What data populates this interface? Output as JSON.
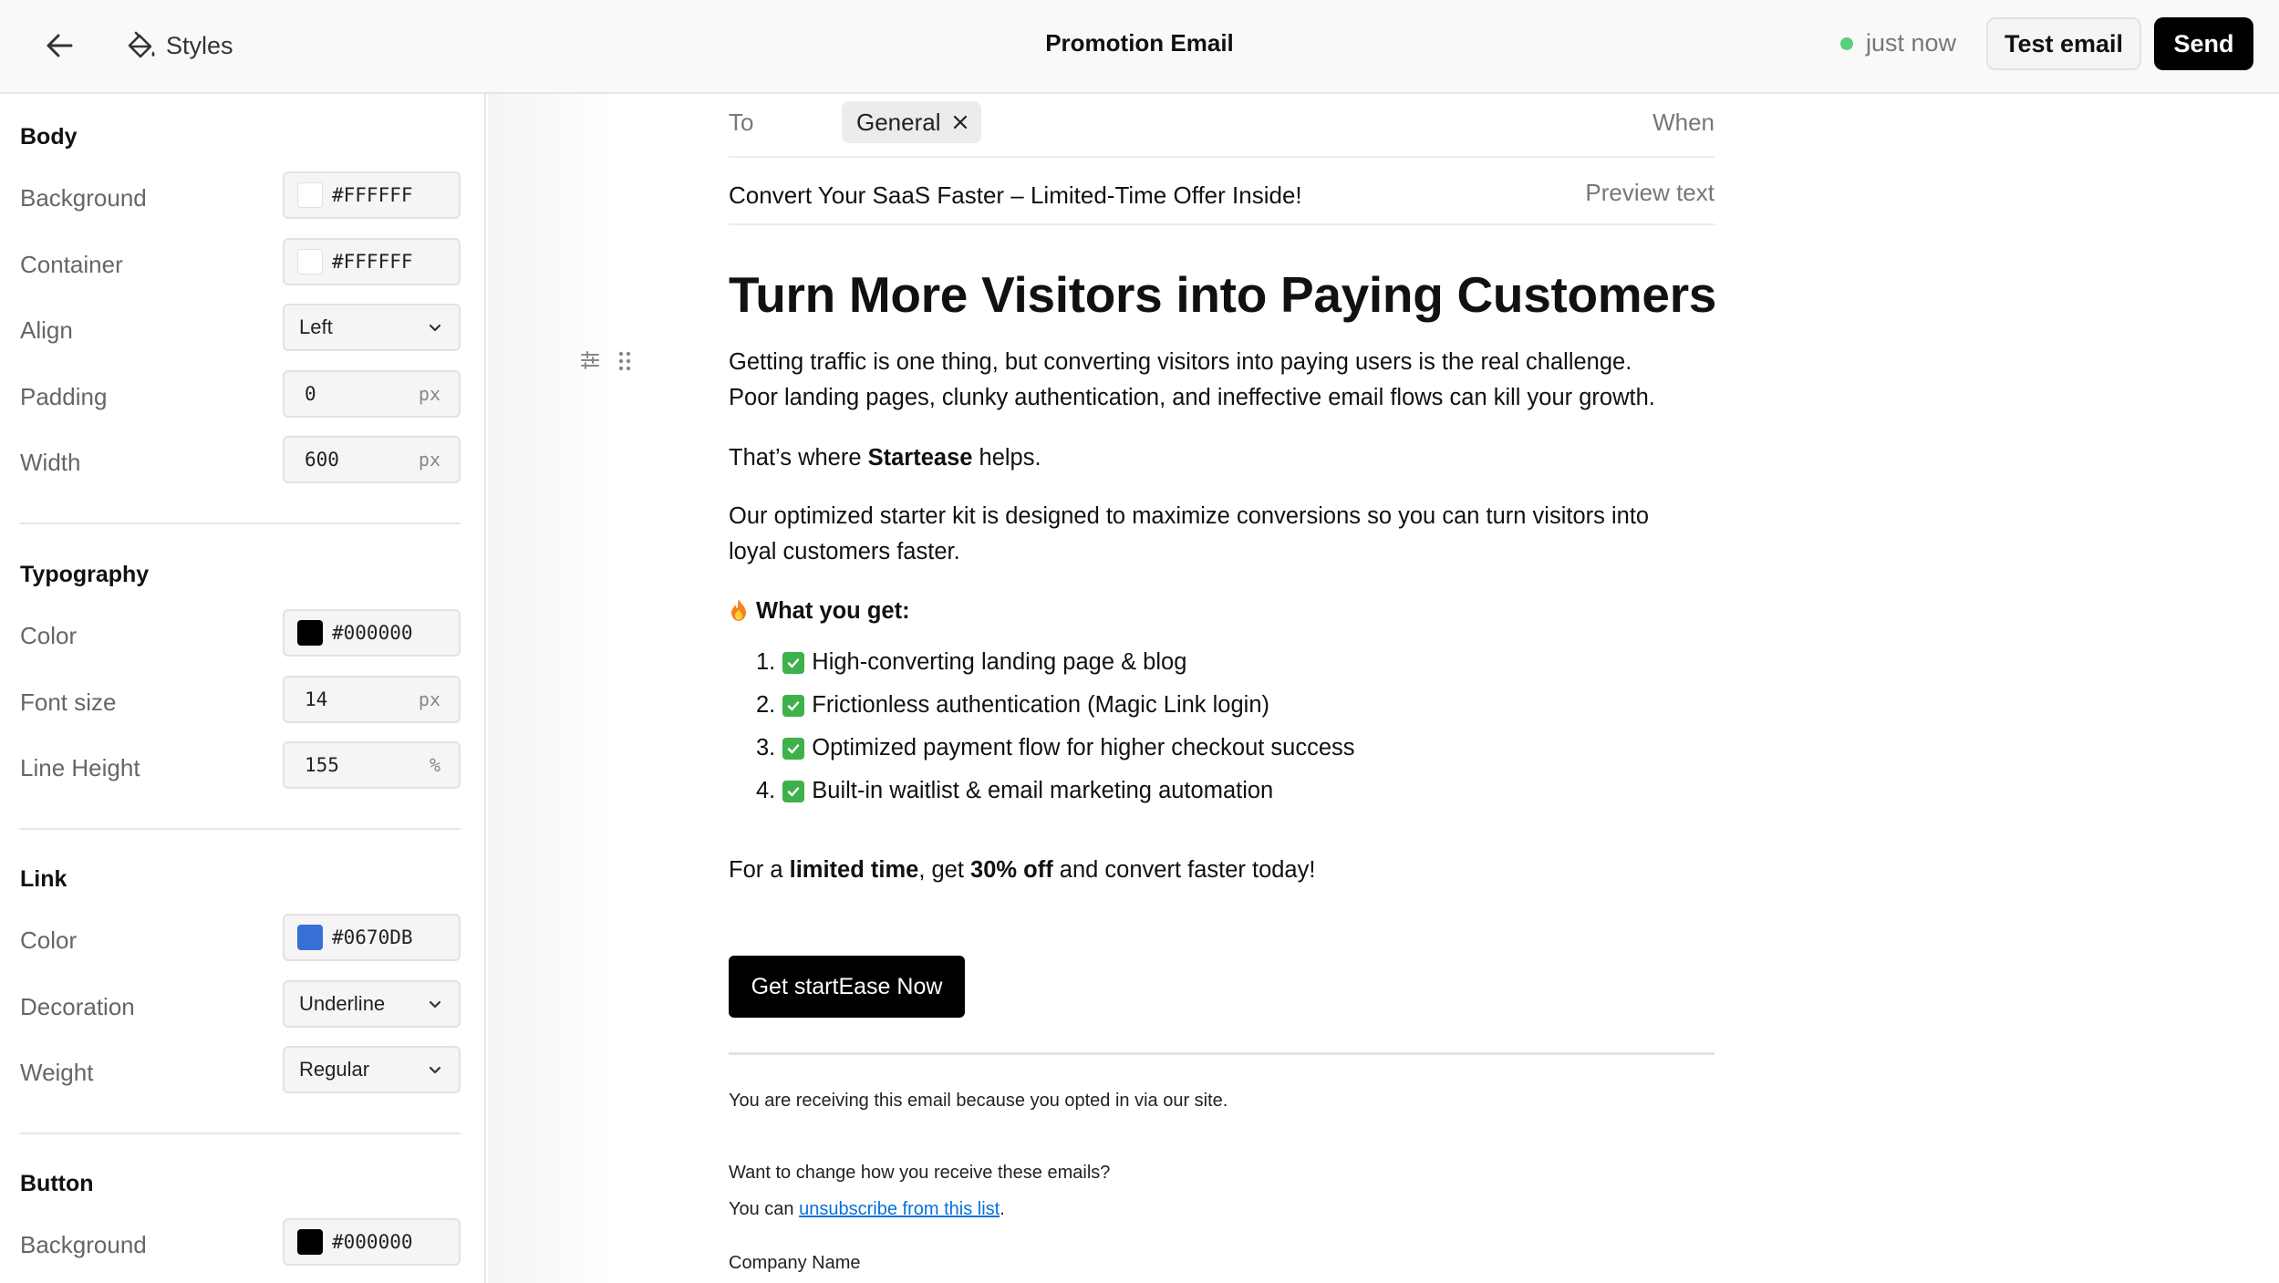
{
  "header": {
    "back_icon": "arrow-left-icon",
    "styles_label": "Styles",
    "styles_icon": "paint-bucket-icon",
    "title": "Promotion Email",
    "status_text": "just now",
    "status_color": "#5ccf7f",
    "test_email_label": "Test email",
    "send_label": "Send"
  },
  "sidebar": {
    "body": {
      "title": "Body",
      "background_label": "Background",
      "background_value": "#FFFFFF",
      "container_label": "Container",
      "container_value": "#FFFFFF",
      "align_label": "Align",
      "align_value": "Left",
      "padding_label": "Padding",
      "padding_value": "0",
      "padding_unit": "px",
      "width_label": "Width",
      "width_value": "600",
      "width_unit": "px"
    },
    "typography": {
      "title": "Typography",
      "color_label": "Color",
      "color_value": "#000000",
      "font_size_label": "Font size",
      "font_size_value": "14",
      "font_size_unit": "px",
      "line_height_label": "Line Height",
      "line_height_value": "155",
      "line_height_unit": "%"
    },
    "link": {
      "title": "Link",
      "color_label": "Color",
      "color_value": "#0670DB",
      "decoration_label": "Decoration",
      "decoration_value": "Underline",
      "weight_label": "Weight",
      "weight_value": "Regular"
    },
    "button": {
      "title": "Button",
      "background_label": "Background",
      "background_value": "#000000"
    }
  },
  "email": {
    "to_label": "To",
    "recipient_chip": "General",
    "when_label": "When",
    "subject": "Convert Your SaaS Faster – Limited-Time Offer Inside!",
    "preview_placeholder": "Preview text",
    "heading": "Turn More Visitors into Paying Customers",
    "para1_line1": "Getting traffic is one thing, but converting visitors into paying users is the real challenge.",
    "para1_line2": "Poor landing pages, clunky authentication, and ineffective email flows can kill your growth.",
    "para2_pre": "That’s where ",
    "para2_bold": "Startease",
    "para2_post": " helps.",
    "para3_line1": "Our optimized starter kit is designed to maximize conversions so you can turn visitors into",
    "para3_line2": "loyal customers faster.",
    "what_you_get": "What you get:",
    "list": [
      {
        "num": "1.",
        "text": "High-converting landing page & blog"
      },
      {
        "num": "2.",
        "text": "Frictionless authentication (Magic Link login)"
      },
      {
        "num": "3.",
        "text": "Optimized payment flow for higher checkout success"
      },
      {
        "num": "4.",
        "text": "Built-in waitlist & email marketing automation"
      }
    ],
    "offer_pre": "For a ",
    "offer_bold1": "limited time",
    "offer_mid": ", get ",
    "offer_bold2": "30% off",
    "offer_post": " and convert faster today!",
    "cta_label": "Get startEase Now",
    "footer_line1": "You are receiving this email because you opted in via our site.",
    "footer_line2": "Want to change how you receive these emails?",
    "footer_line3_pre": "You can ",
    "footer_link": "unsubscribe from this list",
    "footer_line3_post": ".",
    "company": "Company Name"
  }
}
